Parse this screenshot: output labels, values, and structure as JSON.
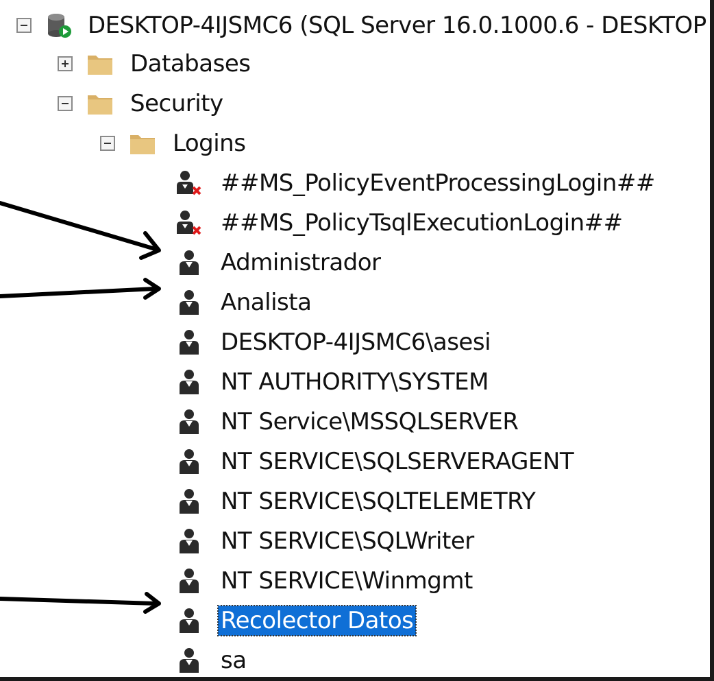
{
  "tree": {
    "server": {
      "label": "DESKTOP-4IJSMC6 (SQL Server 16.0.1000.6 - DESKTOP",
      "icon": "server-running-icon",
      "expanded": true
    },
    "databases": {
      "label": "Databases",
      "icon": "folder-icon",
      "expanded": false
    },
    "security": {
      "label": "Security",
      "icon": "folder-icon",
      "expanded": true
    },
    "logins": {
      "label": "Logins",
      "icon": "folder-icon",
      "expanded": true
    },
    "login_items": [
      {
        "label": "##MS_PolicyEventProcessingLogin##",
        "icon": "user-disabled-icon",
        "selected": false
      },
      {
        "label": "##MS_PolicyTsqlExecutionLogin##",
        "icon": "user-disabled-icon",
        "selected": false
      },
      {
        "label": "Administrador",
        "icon": "user-icon",
        "selected": false
      },
      {
        "label": "Analista",
        "icon": "user-icon",
        "selected": false
      },
      {
        "label": "DESKTOP-4IJSMC6\\asesi",
        "icon": "user-icon",
        "selected": false
      },
      {
        "label": "NT AUTHORITY\\SYSTEM",
        "icon": "user-icon",
        "selected": false
      },
      {
        "label": "NT Service\\MSSQLSERVER",
        "icon": "user-icon",
        "selected": false
      },
      {
        "label": "NT SERVICE\\SQLSERVERAGENT",
        "icon": "user-icon",
        "selected": false
      },
      {
        "label": "NT SERVICE\\SQLTELEMETRY",
        "icon": "user-icon",
        "selected": false
      },
      {
        "label": "NT SERVICE\\SQLWriter",
        "icon": "user-icon",
        "selected": false
      },
      {
        "label": "NT SERVICE\\Winmgmt",
        "icon": "user-icon",
        "selected": false
      },
      {
        "label": "Recolector Datos",
        "icon": "user-icon",
        "selected": true
      },
      {
        "label": "sa",
        "icon": "user-icon",
        "selected": false
      }
    ]
  },
  "colors": {
    "selection": "#0f6fd6",
    "folder": "#e8c680",
    "disabled_x": "#e01b1b",
    "annotation_arrow": "#000000"
  },
  "annotations": {
    "arrows_point_to": [
      "Administrador",
      "Analista",
      "Recolector Datos"
    ]
  }
}
